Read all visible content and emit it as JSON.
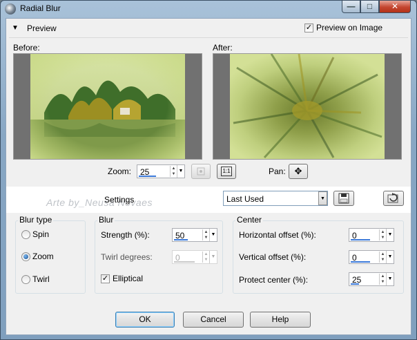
{
  "window": {
    "title": "Radial Blur",
    "close_glyph": "✕",
    "min_glyph": "—",
    "max_glyph": "□"
  },
  "preview": {
    "header": "Preview",
    "preview_on_image_label": "Preview on Image",
    "preview_on_image_checked": true,
    "before_label": "Before:",
    "after_label": "After:",
    "zoom_label": "Zoom:",
    "zoom_value": "25",
    "pan_label": "Pan:",
    "one_to_one": "1:1"
  },
  "settings": {
    "label": "Settings",
    "watermark": "Arte by_Neusa Novaes",
    "preset_value": "Last Used"
  },
  "blur_type": {
    "title": "Blur type",
    "options": [
      {
        "label": "Spin",
        "selected": false
      },
      {
        "label": "Zoom",
        "selected": true
      },
      {
        "label": "Twirl",
        "selected": false
      }
    ]
  },
  "blur": {
    "title": "Blur",
    "strength_label": "Strength (%):",
    "strength_value": "50",
    "twirl_label": "Twirl degrees:",
    "twirl_value": "0",
    "elliptical_label": "Elliptical",
    "elliptical_checked": true
  },
  "center": {
    "title": "Center",
    "h_offset_label": "Horizontal offset (%):",
    "h_offset_value": "0",
    "v_offset_label": "Vertical offset (%):",
    "v_offset_value": "0",
    "protect_label": "Protect center (%):",
    "protect_value": "25"
  },
  "buttons": {
    "ok": "OK",
    "cancel": "Cancel",
    "help": "Help"
  },
  "colors": {
    "accent": "#3a78d8",
    "window_chrome": "#88a7c4",
    "client_bg": "#f0f0f0"
  }
}
